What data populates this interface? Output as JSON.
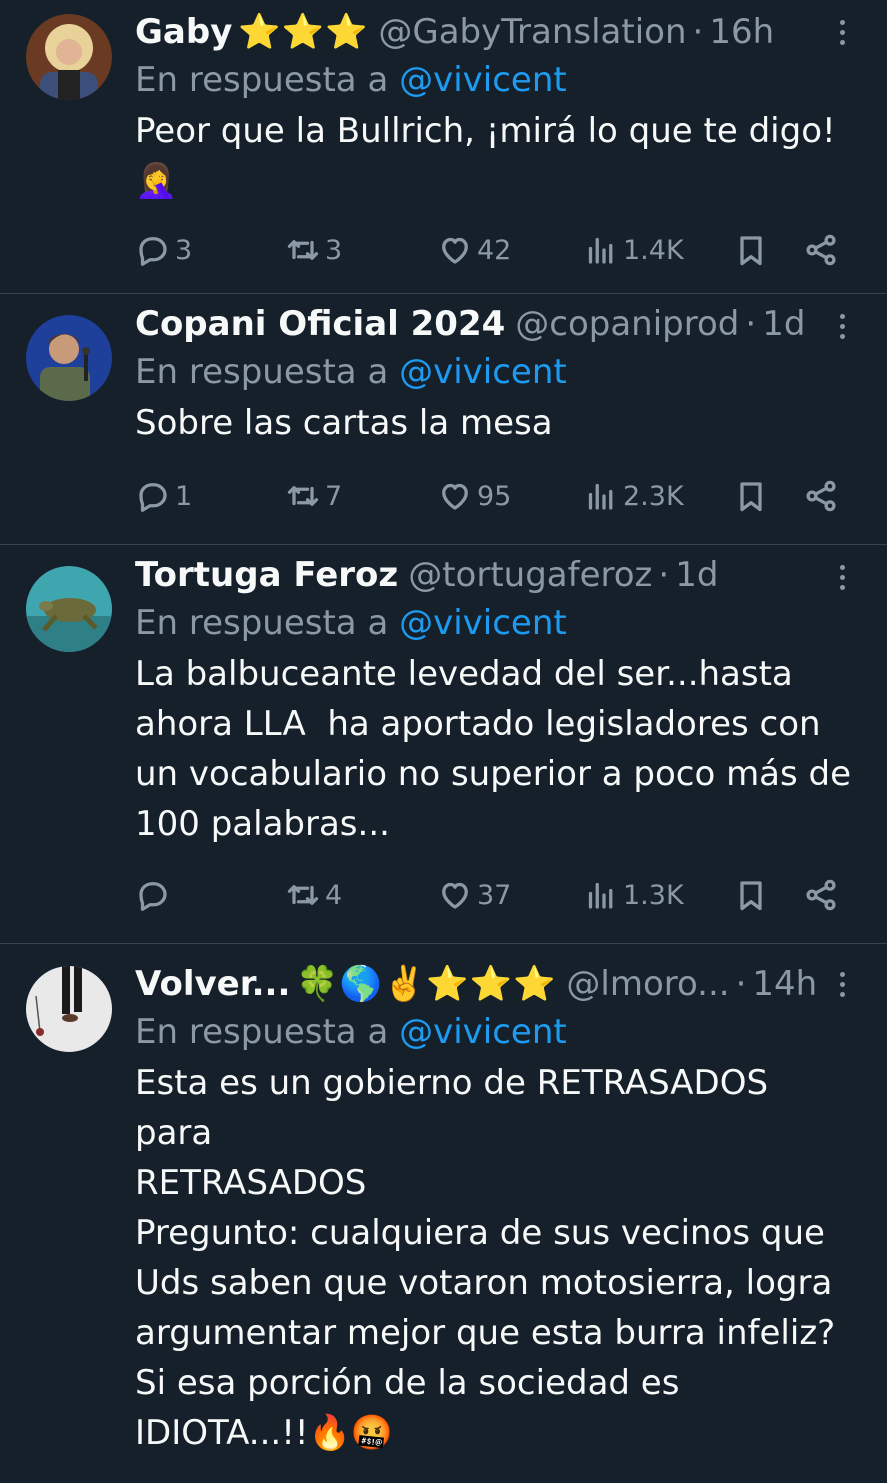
{
  "replies": [
    {
      "name": "Gaby",
      "badges": "⭐⭐⭐",
      "handle": "@GabyTranslation",
      "time": "16h",
      "reply_prefix": "En respuesta a",
      "reply_to": "@vivicent",
      "text": "Peor que la Bullrich, ¡mirá lo que te digo!\n🤦‍♀️",
      "replies": "3",
      "retweets": "3",
      "likes": "42",
      "views": "1.4K"
    },
    {
      "name": "Copani Oficial 2024",
      "badges": "",
      "handle": "@copaniprod",
      "time": "1d",
      "reply_prefix": "En respuesta a",
      "reply_to": "@vivicent",
      "text": "Sobre las cartas la mesa",
      "replies": "1",
      "retweets": "7",
      "likes": "95",
      "views": "2.3K"
    },
    {
      "name": "Tortuga Feroz",
      "badges": "",
      "handle": "@tortugaferoz",
      "time": "1d",
      "reply_prefix": "En respuesta a",
      "reply_to": "@vivicent",
      "text": "La balbuceante levedad del ser...hasta\nahora LLA  ha aportado legisladores con\nun vocabulario no superior a poco más de\n100 palabras...",
      "replies": "",
      "retweets": "4",
      "likes": "37",
      "views": "1.3K"
    },
    {
      "name": "Volver...",
      "badges": "🍀🌎✌️⭐⭐⭐",
      "handle": "@lmoro...",
      "time": "14h",
      "reply_prefix": "En respuesta a",
      "reply_to": "@vivicent",
      "text": "Esta es un gobierno de RETRASADOS\npara\nRETRASADOS\nPregunto: cualquiera de sus vecinos que\nUds saben que votaron motosierra, logra\nargumentar mejor que esta burra infeliz?\nSi esa porción de la sociedad es\nIDIOTA...!!🔥🤬",
      "replies": "",
      "retweets": "",
      "likes": "",
      "views": ""
    }
  ],
  "colors": {
    "background": "#15202b",
    "text": "#f7f9f9",
    "muted": "#8b98a5",
    "link": "#1d9bf0",
    "divider": "#38444d"
  }
}
